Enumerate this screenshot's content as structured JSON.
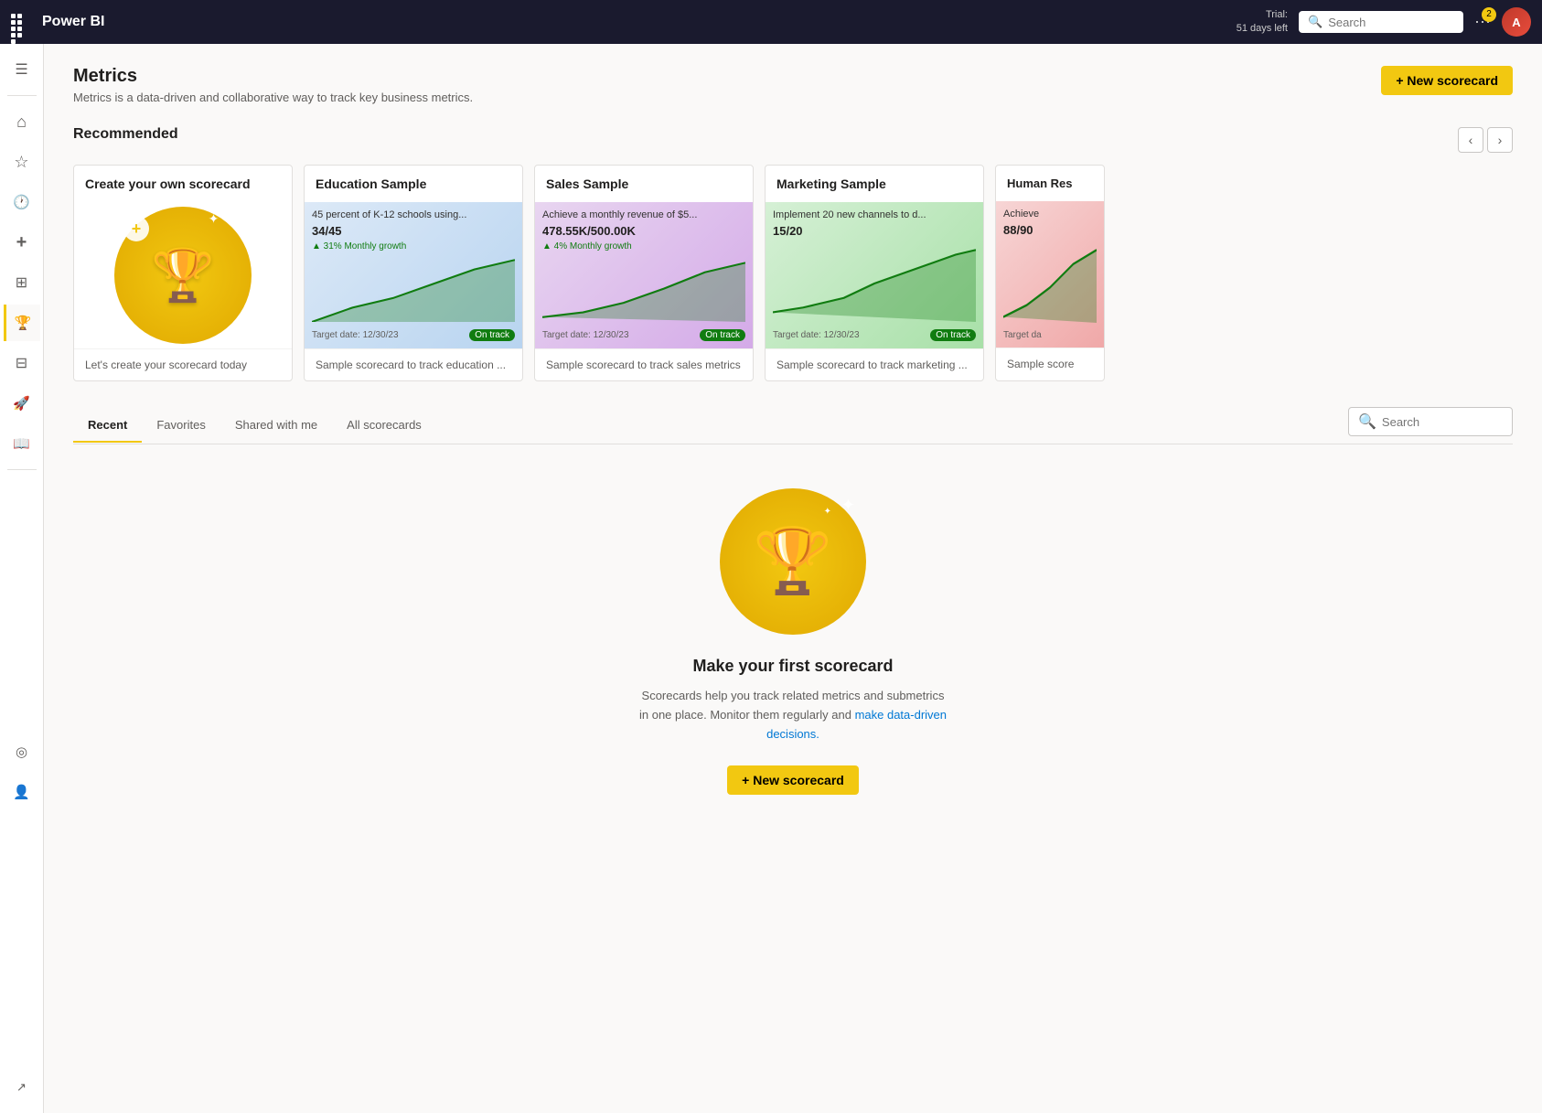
{
  "topnav": {
    "brand": "Power BI",
    "trial_line1": "Trial:",
    "trial_line2": "51 days left",
    "search_placeholder": "Search",
    "notif_count": "2",
    "avatar_initials": "A"
  },
  "sidebar": {
    "items": [
      {
        "id": "menu",
        "icon": "☰",
        "label": "Menu"
      },
      {
        "id": "home",
        "icon": "⌂",
        "label": "Home"
      },
      {
        "id": "favorites",
        "icon": "☆",
        "label": "Favorites"
      },
      {
        "id": "recent",
        "icon": "🕐",
        "label": "Recent"
      },
      {
        "id": "create",
        "icon": "+",
        "label": "Create"
      },
      {
        "id": "apps",
        "icon": "⊞",
        "label": "Apps"
      },
      {
        "id": "metrics",
        "icon": "🏆",
        "label": "Metrics",
        "active": true
      },
      {
        "id": "workspaces",
        "icon": "⊟",
        "label": "Workspaces"
      },
      {
        "id": "deployment",
        "icon": "🚀",
        "label": "Deployment"
      },
      {
        "id": "learn",
        "icon": "📖",
        "label": "Learn"
      },
      {
        "id": "hub",
        "icon": "◎",
        "label": "Data hub"
      },
      {
        "id": "profile",
        "icon": "👤",
        "label": "Profile"
      }
    ]
  },
  "page": {
    "title": "Metrics",
    "subtitle": "Metrics is a data-driven and collaborative way to track key business metrics.",
    "new_scorecard_label": "+ New scorecard"
  },
  "recommended": {
    "section_title": "Recommended",
    "cards": [
      {
        "id": "create-own",
        "title": "Create your own scorecard",
        "footer": "Let's create your scorecard today",
        "type": "create"
      },
      {
        "id": "education",
        "title": "Education Sample",
        "metric_title": "45 percent of K-12 schools using...",
        "metric_value": "34/45",
        "growth": "31% Monthly growth",
        "target_date": "Target date: 12/30/23",
        "on_track": "On track",
        "footer": "Sample scorecard to track education ...",
        "type": "sample",
        "bg": "blue"
      },
      {
        "id": "sales",
        "title": "Sales Sample",
        "metric_title": "Achieve a monthly revenue of $5...",
        "metric_value": "478.55K/500.00K",
        "growth": "4% Monthly growth",
        "target_date": "Target date: 12/30/23",
        "on_track": "On track",
        "footer": "Sample scorecard to track sales metrics",
        "type": "sample",
        "bg": "purple"
      },
      {
        "id": "marketing",
        "title": "Marketing Sample",
        "metric_title": "Implement 20 new channels to d...",
        "metric_value": "15/20",
        "growth": "",
        "target_date": "Target date: 12/30/23",
        "on_track": "On track",
        "footer": "Sample scorecard to track marketing ...",
        "type": "sample",
        "bg": "green"
      },
      {
        "id": "human-res",
        "title": "Human Res",
        "metric_title": "Achieve",
        "metric_value": "88/90",
        "growth": "",
        "target_date": "Target da",
        "on_track": "",
        "footer": "Sample score",
        "type": "sample",
        "bg": "pink",
        "partial": true
      }
    ]
  },
  "tabs": {
    "items": [
      {
        "id": "recent",
        "label": "Recent",
        "active": true
      },
      {
        "id": "favorites",
        "label": "Favorites",
        "active": false
      },
      {
        "id": "shared",
        "label": "Shared with me",
        "active": false
      },
      {
        "id": "all",
        "label": "All scorecards",
        "active": false
      }
    ],
    "search_placeholder": "Search"
  },
  "empty_state": {
    "title": "Make your first scorecard",
    "desc_part1": "Scorecards help you track related metrics and submetrics in one place. Monitor them regularly and ",
    "desc_link": "make data-driven decisions.",
    "btn_label": "+ New scorecard"
  }
}
